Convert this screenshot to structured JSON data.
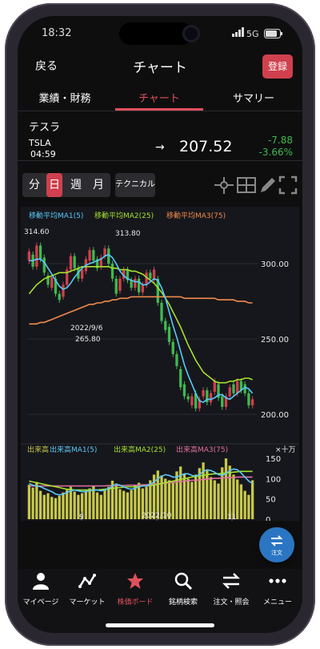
{
  "status": {
    "time": "18:32",
    "signal": "5G"
  },
  "nav": {
    "back": "戻る",
    "title": "チャート",
    "login": "登録"
  },
  "tabs": [
    "業績・財務",
    "チャート",
    "サマリー"
  ],
  "stock": {
    "name": "テスラ",
    "ticker": "TSLA",
    "time": "04:59",
    "arrow": "→",
    "price": "207.52",
    "change": "-7.88",
    "change_pct": "-3.66%"
  },
  "periods": [
    "分",
    "日",
    "週",
    "月"
  ],
  "technical_label": "テクニカル",
  "colors": {
    "accent": "#d0404e",
    "ma1": "#5ac8fa",
    "ma2": "#a6e22e",
    "ma3": "#f08a4b",
    "up": "#d0404e",
    "down": "#3fb950",
    "vol": "#c8c84a"
  },
  "chart_data": {
    "type": "line",
    "price_legend": [
      {
        "label": "移動平均MA1(5)",
        "color": "#5ac8fa"
      },
      {
        "label": "移動平均MA2(25)",
        "color": "#a6e22e"
      },
      {
        "label": "移動平均MA3(75)",
        "color": "#f08a4b"
      }
    ],
    "volume_legend": [
      {
        "label": "出来高",
        "color": "#c8c84a"
      },
      {
        "label": "出来高MA1(5)",
        "color": "#5ac8fa"
      },
      {
        "label": "出来高MA2(25)",
        "color": "#a6e22e"
      },
      {
        "label": "出来高MA3(75)",
        "color": "#e070a0"
      }
    ],
    "price_ticks": [
      "300.00",
      "250.00",
      "200.00"
    ],
    "volume_unit": "×十万",
    "volume_ticks": [
      "150",
      "100",
      "50",
      "0"
    ],
    "x_ticks": [
      "9",
      "2022/10",
      "11"
    ],
    "annotations": [
      "314.60",
      "313.80",
      "2022/9/6",
      "265.80"
    ],
    "ylim": [
      190,
      325
    ],
    "candles": [
      [
        302,
        308
      ],
      [
        306,
        298
      ],
      [
        298,
        312
      ],
      [
        312,
        303
      ],
      [
        304,
        294
      ],
      [
        292,
        286
      ],
      [
        284,
        291
      ],
      [
        290,
        280
      ],
      [
        280,
        276
      ],
      [
        278,
        286
      ],
      [
        286,
        296
      ],
      [
        296,
        305
      ],
      [
        305,
        297
      ],
      [
        297,
        290
      ],
      [
        290,
        296
      ],
      [
        295,
        303
      ],
      [
        302,
        309
      ],
      [
        309,
        302
      ],
      [
        303,
        297
      ],
      [
        298,
        304
      ],
      [
        305,
        310
      ],
      [
        310,
        300
      ],
      [
        300,
        290
      ],
      [
        290,
        280
      ],
      [
        282,
        290
      ],
      [
        290,
        296
      ],
      [
        296,
        289
      ],
      [
        289,
        284
      ],
      [
        284,
        290
      ],
      [
        290,
        281
      ],
      [
        281,
        286
      ],
      [
        286,
        294
      ],
      [
        294,
        290
      ],
      [
        289,
        296
      ],
      [
        290,
        274
      ],
      [
        274,
        262
      ],
      [
        262,
        256
      ],
      [
        258,
        248
      ],
      [
        248,
        240
      ],
      [
        240,
        232
      ],
      [
        230,
        218
      ],
      [
        220,
        212
      ],
      [
        212,
        210
      ],
      [
        206,
        212
      ],
      [
        214,
        204
      ],
      [
        204,
        210
      ],
      [
        212,
        216
      ],
      [
        216,
        208
      ],
      [
        208,
        214
      ],
      [
        215,
        222
      ],
      [
        220,
        211
      ],
      [
        212,
        205
      ],
      [
        205,
        212
      ],
      [
        212,
        218
      ],
      [
        220,
        214
      ],
      [
        214,
        222
      ],
      [
        222,
        216
      ],
      [
        220,
        214
      ],
      [
        214,
        206
      ],
      [
        206,
        210
      ]
    ],
    "ma1": [
      302,
      302,
      303,
      303,
      301,
      297,
      293,
      289,
      285,
      283,
      284,
      287,
      291,
      294,
      297,
      299,
      300,
      301,
      302,
      303,
      305,
      306,
      304,
      300,
      295,
      292,
      290,
      289,
      288,
      288,
      286,
      286,
      288,
      290,
      289,
      284,
      277,
      268,
      259,
      251,
      242,
      233,
      226,
      220,
      214,
      209,
      208,
      210,
      210,
      211,
      213,
      213,
      211,
      210,
      212,
      214,
      216,
      218,
      217,
      214
    ],
    "ma2": [
      280,
      283,
      286,
      288,
      290,
      291,
      292,
      293,
      294,
      294,
      294,
      295,
      296,
      297,
      298,
      298,
      298,
      298,
      298,
      298,
      298,
      298,
      297,
      297,
      296,
      296,
      296,
      295,
      295,
      294,
      293,
      291,
      289,
      287,
      284,
      281,
      277,
      273,
      268,
      263,
      258,
      252,
      246,
      241,
      236,
      232,
      228,
      226,
      224,
      222,
      221,
      221,
      221,
      222,
      222,
      223,
      223,
      224,
      224,
      223
    ],
    "ma3": [
      260,
      260,
      260,
      261,
      261,
      262,
      263,
      264,
      265,
      266,
      267,
      268,
      269,
      270,
      271,
      272,
      273,
      273,
      274,
      274,
      275,
      275,
      276,
      276,
      277,
      277,
      277,
      278,
      278,
      278,
      278,
      278,
      278,
      278,
      278,
      278,
      278,
      278,
      278,
      278,
      278,
      277,
      277,
      277,
      277,
      277,
      277,
      277,
      277,
      277,
      276,
      276,
      276,
      276,
      276,
      275,
      275,
      275,
      274,
      274
    ],
    "volume": [
      85,
      78,
      92,
      70,
      60,
      64,
      55,
      52,
      58,
      66,
      72,
      80,
      68,
      60,
      64,
      70,
      76,
      82,
      66,
      60,
      72,
      80,
      95,
      88,
      74,
      70,
      66,
      72,
      84,
      90,
      76,
      80,
      96,
      110,
      120,
      108,
      100,
      96,
      92,
      118,
      130,
      112,
      100,
      92,
      110,
      126,
      140,
      120,
      104,
      96,
      88,
      128,
      150,
      132,
      110,
      98,
      86,
      70,
      60,
      96
    ],
    "volume_ylim": [
      0,
      170
    ],
    "vma1": [
      88,
      84,
      82,
      80,
      76,
      72,
      68,
      62,
      60,
      62,
      66,
      70,
      72,
      70,
      68,
      68,
      70,
      72,
      72,
      70,
      72,
      76,
      82,
      86,
      84,
      80,
      76,
      74,
      76,
      80,
      82,
      82,
      86,
      92,
      100,
      106,
      110,
      108,
      104,
      104,
      108,
      112,
      112,
      108,
      106,
      110,
      118,
      122,
      120,
      116,
      110,
      108,
      112,
      120,
      124,
      122,
      114,
      104,
      94,
      88
    ],
    "vma2": [
      94,
      92,
      90,
      88,
      86,
      84,
      82,
      80,
      78,
      76,
      74,
      73,
      72,
      72,
      72,
      72,
      72,
      72,
      72,
      73,
      74,
      75,
      76,
      77,
      78,
      79,
      80,
      80,
      80,
      81,
      82,
      82,
      83,
      84,
      86,
      88,
      90,
      92,
      94,
      96,
      98,
      100,
      102,
      104,
      106,
      107,
      108,
      110,
      111,
      112,
      112,
      113,
      114,
      115,
      116,
      117,
      118,
      118,
      118,
      118
    ],
    "vma3": [
      82,
      82,
      82,
      82,
      82,
      82,
      82,
      82,
      82,
      82,
      82,
      82,
      82,
      82,
      82,
      82,
      82,
      82,
      82,
      82,
      82,
      83,
      83,
      83,
      83,
      83,
      84,
      84,
      84,
      84,
      85,
      85,
      86,
      86,
      87,
      88,
      89,
      90,
      91,
      92,
      93,
      94,
      95,
      96,
      96,
      97,
      98,
      99,
      100,
      101,
      101,
      102,
      102,
      103,
      103,
      104,
      104,
      104,
      104,
      104
    ]
  },
  "fab": {
    "label": "注文"
  },
  "bottom_nav": [
    "マイページ",
    "マーケット",
    "株価ボード",
    "銘柄検索",
    "注文・照会",
    "メニュー"
  ]
}
